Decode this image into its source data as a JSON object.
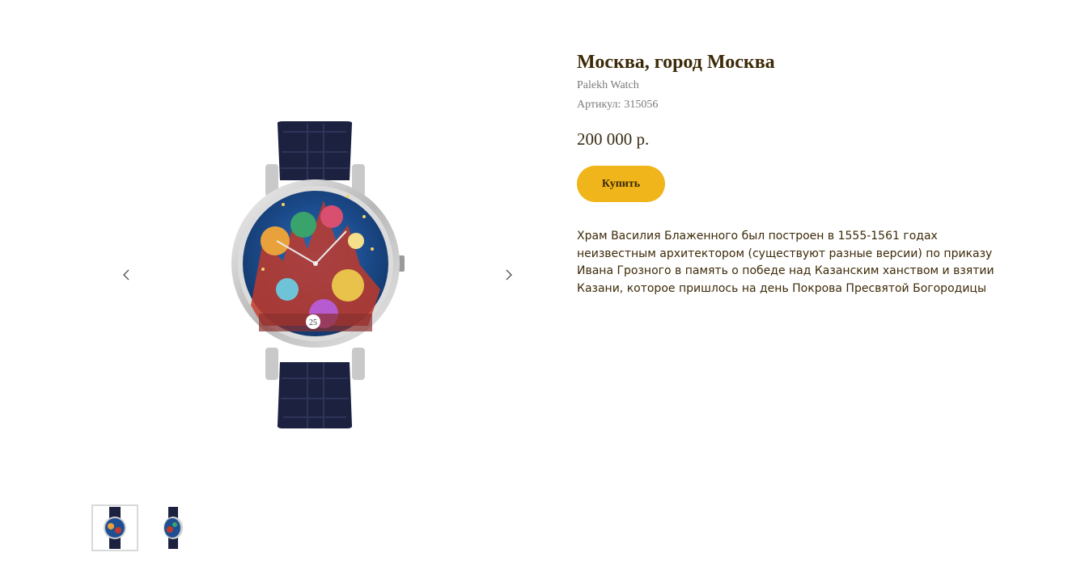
{
  "product": {
    "title": "Москва, город Москва",
    "brand": "Palekh Watch",
    "sku_label": "Артикул:",
    "sku": "315056",
    "price": "200 000 р.",
    "buy_label": "Купить",
    "description": "Храм Василия Блаженного был построен в 1555-1561 годах неизвестным архитектором (существуют разные версии) по приказу Ивана Грозного в память о победе над Казанским ханством и взятии Казани, которое пришлось на день Покрова Пресвятой Богородицы"
  },
  "gallery": {
    "prev_icon": "chevron-left-icon",
    "next_icon": "chevron-right-icon",
    "dial_date": "25"
  },
  "colors": {
    "accent": "#f0b51a",
    "title": "#3d2a08",
    "muted": "#7a7a7a",
    "strap": "#1c2140"
  }
}
